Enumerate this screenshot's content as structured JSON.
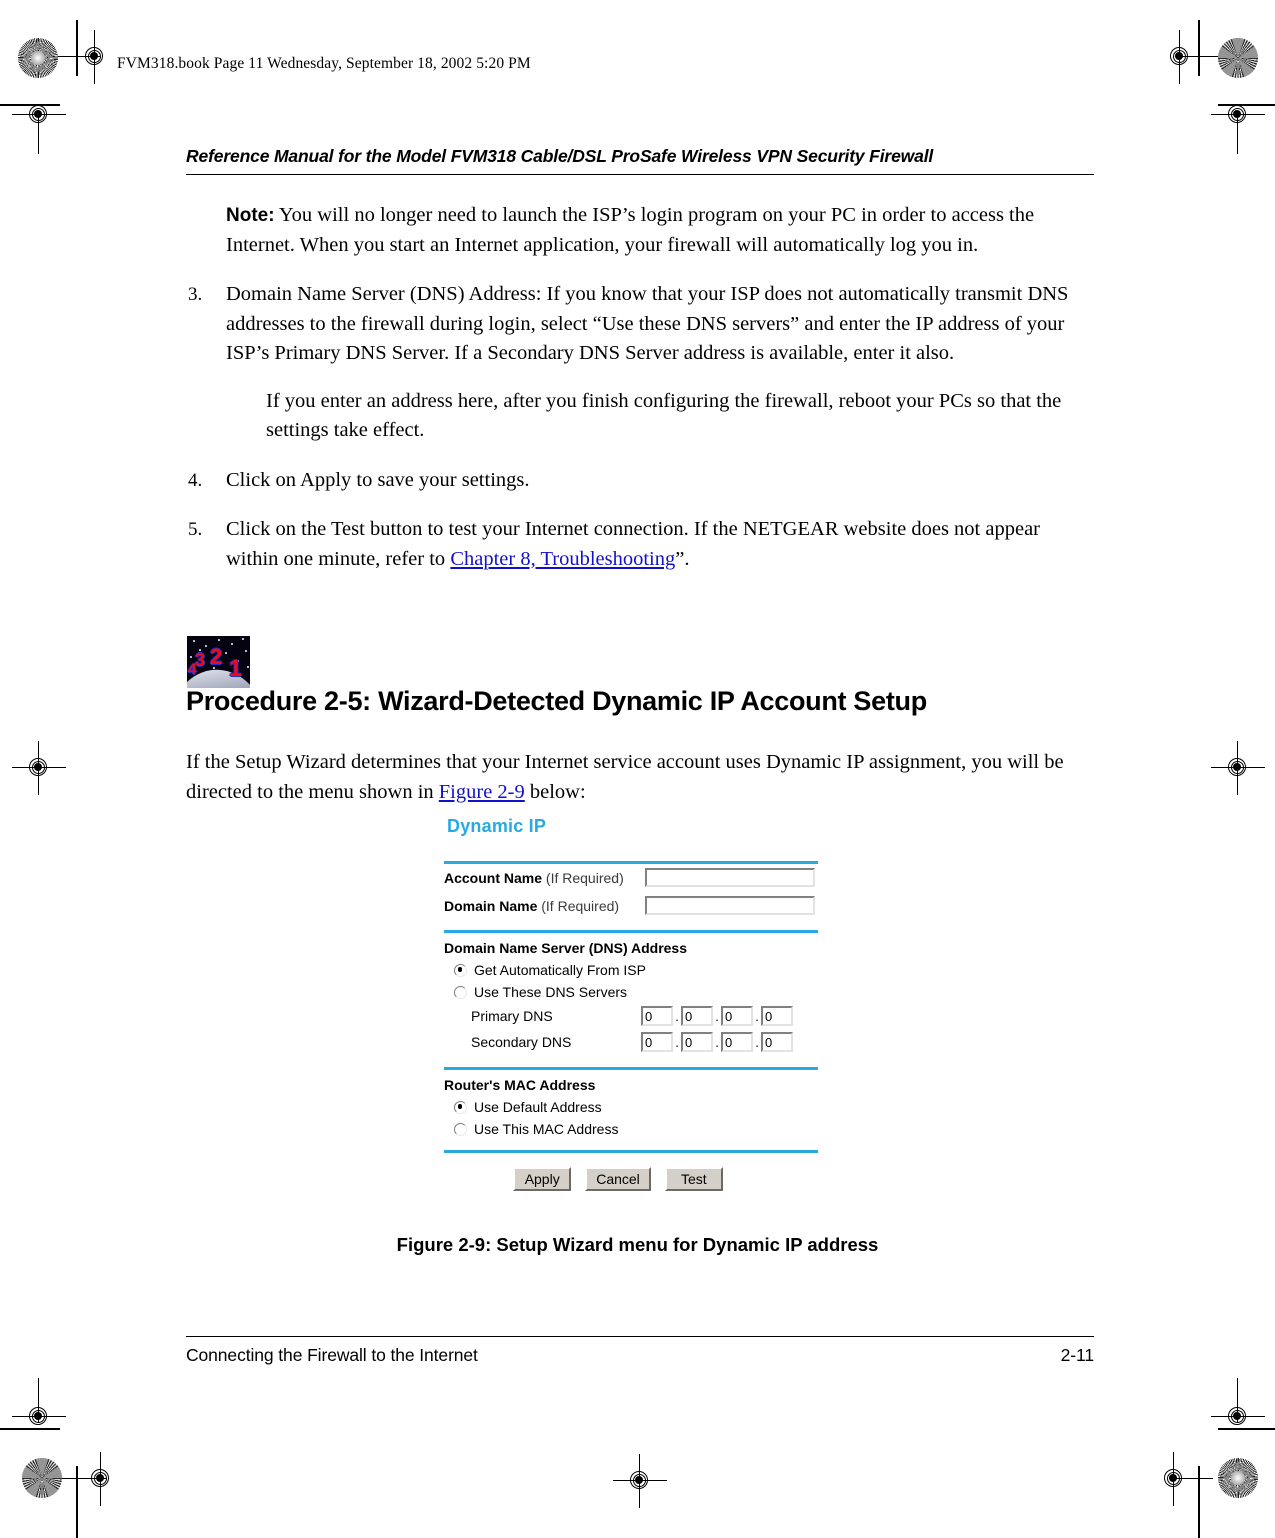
{
  "print_stamp": "FVM318.book  Page 11  Wednesday, September 18, 2002  5:20 PM",
  "running_head": "Reference Manual for the Model FVM318 Cable/DSL ProSafe Wireless VPN Security Firewall",
  "note": {
    "label": "Note:",
    "text": " You will no longer need to launch the ISP’s login program on your PC in order to access the Internet. When you start an Internet application, your firewall will automatically log you in."
  },
  "steps": [
    {
      "number": "3.",
      "text": "Domain Name Server (DNS) Address: If you know that your ISP does not automatically transmit DNS addresses to the firewall during login, select “Use these DNS servers” and enter the IP address of your ISP’s Primary DNS Server. If a Secondary DNS Server address is available, enter it also."
    },
    {
      "number": "4.",
      "text": "Click on Apply to save your settings."
    }
  ],
  "step3_subtext": "If you enter an address here, after you finish configuring the firewall, reboot your PCs so that the settings take effect.",
  "step5": {
    "number": "5.",
    "text_before": "Click on the Test button to test your Internet connection. If the NETGEAR website does not appear within one minute, refer to ",
    "link": "Chapter 8, Troubleshooting",
    "text_after": "”."
  },
  "procedure": {
    "icon_digits": [
      "4",
      "3",
      "2",
      "1"
    ],
    "heading": "Procedure 2-5:  Wizard-Detected Dynamic IP Account Setup",
    "intro_before": "If the Setup Wizard determines that your Internet service account uses Dynamic IP assignment, you will be directed to the menu shown in ",
    "intro_link": "Figure 2-9",
    "intro_after": " below:"
  },
  "figure": {
    "title": "Dynamic IP",
    "title_color": "#29a9e0",
    "account_name": {
      "label": "Account Name",
      "hint": " (If Required)",
      "value": ""
    },
    "domain_name": {
      "label": "Domain Name",
      "hint": " (If Required)",
      "value": ""
    },
    "dns": {
      "section_title": "Domain Name Server (DNS) Address",
      "option_auto": "Get Automatically From ISP",
      "option_manual": "Use These DNS Servers",
      "selected": "auto",
      "primary_label": "Primary DNS",
      "primary_octets": [
        "0",
        "0",
        "0",
        "0"
      ],
      "secondary_label": "Secondary DNS",
      "secondary_octets": [
        "0",
        "0",
        "0",
        "0"
      ]
    },
    "mac": {
      "section_title": "Router's MAC Address",
      "option_default": "Use Default Address",
      "option_custom": "Use This MAC Address",
      "selected": "default"
    },
    "buttons": {
      "apply": "Apply",
      "cancel": "Cancel",
      "test": "Test"
    },
    "caption": "Figure 2-9: Setup Wizard menu for Dynamic IP address"
  },
  "footer": {
    "left": "Connecting the Firewall to the Internet",
    "right": "2-11"
  }
}
